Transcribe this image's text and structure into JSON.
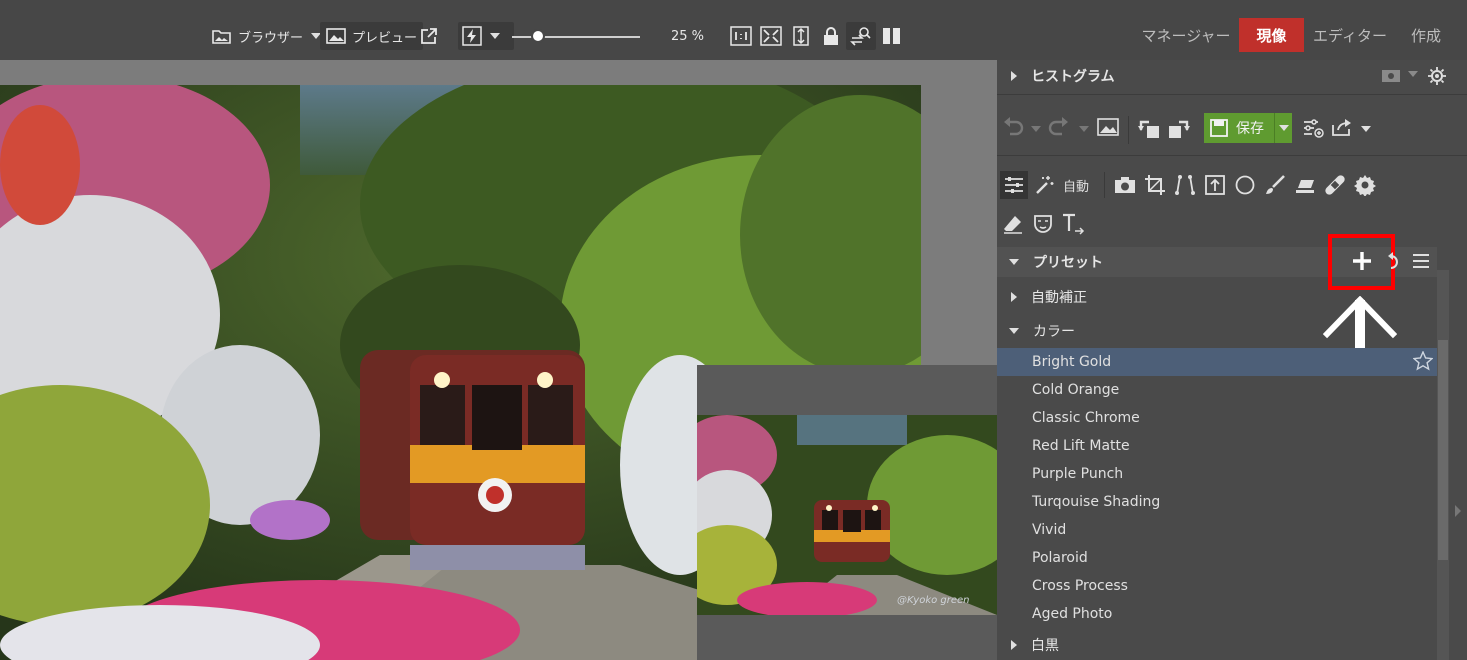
{
  "toolbar": {
    "browser_label": "ブラウザー",
    "preview_label": "プレビュー",
    "zoom_label": "25 %",
    "zoom_fraction": 0.2
  },
  "nav": {
    "manager": "マネージャー",
    "develop": "現像",
    "editor": "エディター",
    "create": "作成"
  },
  "panel": {
    "histogram_label": "ヒストグラム",
    "save_label": "保存",
    "auto_label": "自動",
    "presets_label": "プリセット",
    "auto_correct_label": "自動補正",
    "color_label": "カラー",
    "bw_label": "白黒",
    "color_presets": [
      "Bright Gold",
      "Cold Orange",
      "Classic Chrome",
      "Red Lift Matte",
      "Purple Punch",
      "Turqouise Shading",
      "Vivid",
      "Polaroid",
      "Cross Process",
      "Aged Photo"
    ],
    "selected_index": 0
  },
  "photo": {
    "watermark": "@Kyoko green"
  },
  "colors": {
    "accent_red": "#c0302b",
    "save_green": "#5f9b30",
    "selected_row": "#4d5f78",
    "highlight_box": "#ff0000"
  }
}
